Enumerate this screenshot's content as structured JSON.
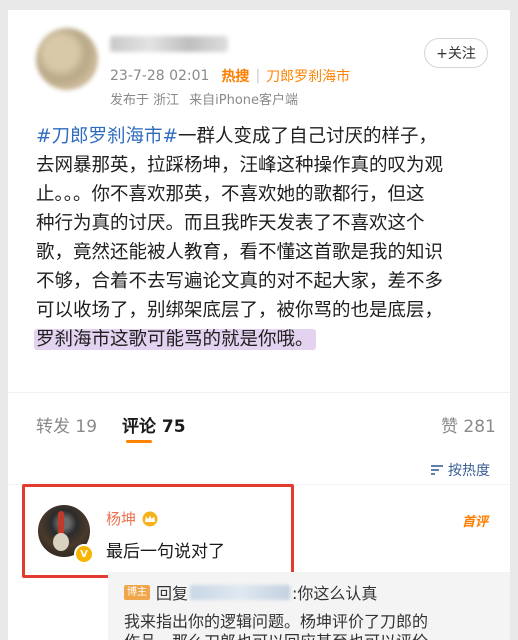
{
  "post": {
    "meta_time": "23-7-28 02:01",
    "hot_label": "热搜",
    "hot_topic": "刀郎罗刹海市",
    "location": "发布于 浙江",
    "source": "来自iPhone客户端",
    "follow_label": "+关注",
    "body": {
      "topic": "#刀郎罗刹海市#",
      "line1_rest": "一群人变成了自己讨厌的样子，",
      "line2": "去网暴那英，拉踩杨坤，汪峰这种操作真的叹为观",
      "line3": "止。。。你不喜欢那英，不喜欢她的歌都行，但这",
      "line4": "种行为真的讨厌。而且我昨天发表了不喜欢这个",
      "line5": "歌，竟然还能被人教育，看不懂这首歌是我的知识",
      "line6": "不够，合着不去写遍论文真的对不起大家，差不多",
      "line7": "可以收场了，别绑架底层了，被你骂的也是底层，",
      "line8_highlight": "罗刹海市这歌可能骂的就是你哦。"
    }
  },
  "tabs": {
    "repost": "转发 19",
    "comments": "评论 75",
    "likes": "赞 281"
  },
  "sort": {
    "label": "按热度",
    "icon": "sort-icon"
  },
  "comment": {
    "name": "杨坤",
    "text": "最后一句说对了",
    "badge": "首评",
    "verified_mark": "V"
  },
  "reply": {
    "author_tag": "博主",
    "prefix": "回复",
    "line1_rest": ":你这么认真",
    "line2": "我来指出你的逻辑问题。杨坤评价了刀郎的",
    "line3": "作品，那么刀郎也可以回应甚至也可以评价"
  },
  "colors": {
    "accent": "#ff8200",
    "topic": "#2f6cbf",
    "highlight": "#e3d3f0",
    "comment_border": "#e23b2f",
    "commenter_name": "#eb7350"
  }
}
